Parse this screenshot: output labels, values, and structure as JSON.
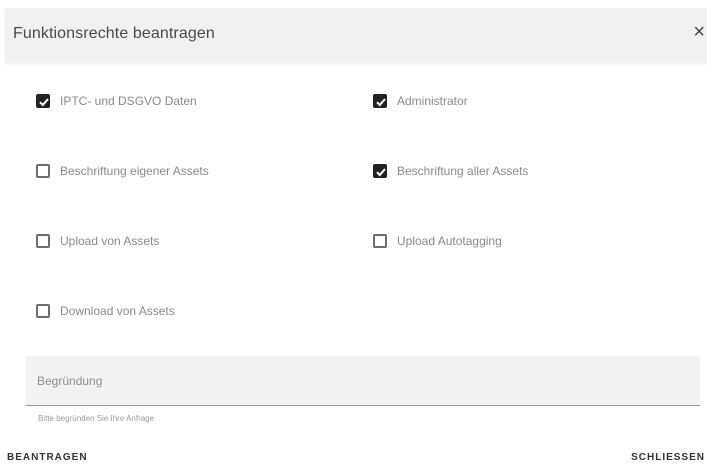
{
  "dialog": {
    "title": "Funktionsrechte beantragen",
    "close_icon": "×"
  },
  "options": [
    {
      "label": "IPTC- und DSGVO Daten",
      "checked": true
    },
    {
      "label": "Administrator",
      "checked": true
    },
    {
      "label": "Beschriftung eigener Assets",
      "checked": false
    },
    {
      "label": "Beschriftung aller Assets",
      "checked": true
    },
    {
      "label": "Upload von Assets",
      "checked": false
    },
    {
      "label": "Upload Autotagging",
      "checked": false
    },
    {
      "label": "Download von Assets",
      "checked": false
    }
  ],
  "reason": {
    "placeholder": "Begründung",
    "helper": "Bitte begründen Sie Ihre Anfrage"
  },
  "actions": {
    "submit_label": "BEANTRAGEN",
    "close_label": "SCHLIESSEN"
  }
}
